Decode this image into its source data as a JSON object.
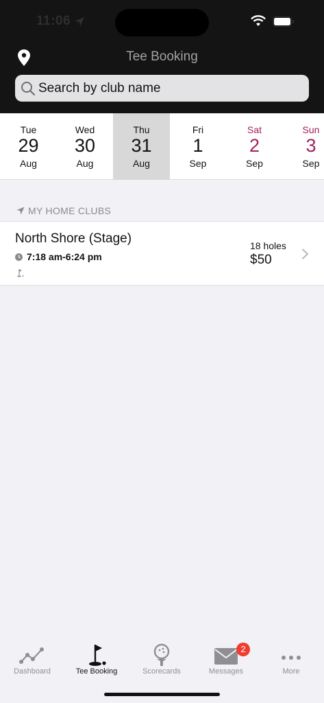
{
  "status_bar": {
    "time": "11:06"
  },
  "header": {
    "title": "Tee Booking"
  },
  "search": {
    "placeholder": "Search by club name"
  },
  "dates": [
    {
      "dow": "Tue",
      "day": "29",
      "month": "Aug",
      "selected": false,
      "weekend": false
    },
    {
      "dow": "Wed",
      "day": "30",
      "month": "Aug",
      "selected": false,
      "weekend": false
    },
    {
      "dow": "Thu",
      "day": "31",
      "month": "Aug",
      "selected": true,
      "weekend": false
    },
    {
      "dow": "Fri",
      "day": "1",
      "month": "Sep",
      "selected": false,
      "weekend": false
    },
    {
      "dow": "Sat",
      "day": "2",
      "month": "Sep",
      "selected": false,
      "weekend": true
    },
    {
      "dow": "Sun",
      "day": "3",
      "month": "Sep",
      "selected": false,
      "weekend": true
    }
  ],
  "section": {
    "title": "MY HOME CLUBS"
  },
  "club": {
    "name": "North Shore (Stage)",
    "hours": "7:18 am-6:24 pm",
    "holes": "18 holes",
    "price": "$50"
  },
  "tabs": [
    {
      "label": "Dashboard",
      "icon": "chart-line-icon",
      "active": false
    },
    {
      "label": "Tee Booking",
      "icon": "golf-flag-icon",
      "active": true
    },
    {
      "label": "Scorecards",
      "icon": "golf-ball-tee-icon",
      "active": false
    },
    {
      "label": "Messages",
      "icon": "envelope-icon",
      "active": false
    },
    {
      "label": "More",
      "icon": "ellipsis-icon",
      "active": false
    }
  ],
  "messages_badge": "2",
  "colors": {
    "header_bg": "#141414",
    "weekend": "#a3205c",
    "selected_date_bg": "#d8d8d8",
    "badge": "#f03b30",
    "inactive_tab": "#8e8e93"
  }
}
